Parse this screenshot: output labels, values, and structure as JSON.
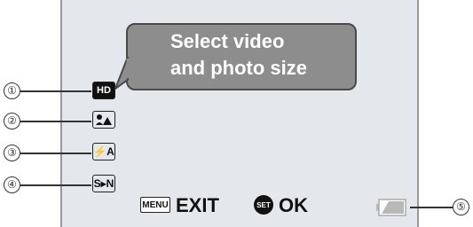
{
  "tooltip": {
    "line1": "Select video",
    "line2": "and photo size"
  },
  "callouts": [
    "①",
    "②",
    "③",
    "④",
    "⑤"
  ],
  "menu_icons": [
    {
      "name": "video-photo-size-icon",
      "label": "HD"
    },
    {
      "name": "scene-select-icon",
      "label": ""
    },
    {
      "name": "flash-mode-icon",
      "label": "⚡A"
    },
    {
      "name": "s-to-n-icon",
      "label": "S▸N"
    }
  ],
  "footer": {
    "menu_key": "MENU",
    "exit_label": "EXIT",
    "set_key": "SET",
    "ok_label": "OK"
  }
}
